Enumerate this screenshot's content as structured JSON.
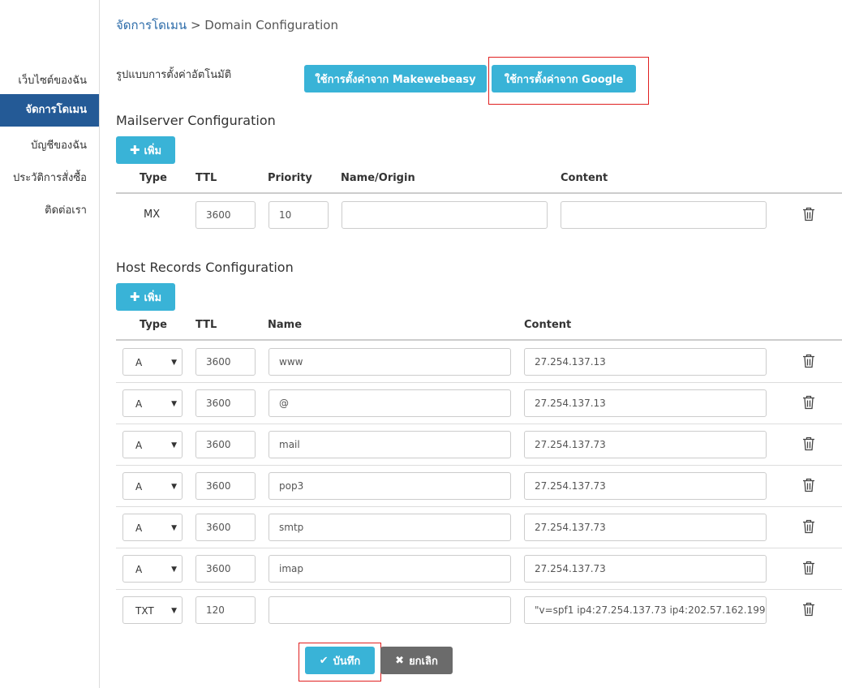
{
  "sidebar": {
    "items": [
      {
        "label": "เว็บไซต์ของฉัน",
        "active": false
      },
      {
        "label": "จัดการโดเมน",
        "active": true
      },
      {
        "label": "บัญชีของฉัน",
        "active": false
      },
      {
        "label": "ประวัติการสั่งซื้อ",
        "active": false
      },
      {
        "label": "ติดต่อเรา",
        "active": false
      }
    ]
  },
  "breadcrumb": {
    "parent": "จัดการโดเมน",
    "separator": " > ",
    "current": "Domain Configuration"
  },
  "preset": {
    "label": "รูปแบบการตั้งค่าอัตโนมัติ",
    "makewebeasy_button": "ใช้การตั้งค่าจาก Makewebeasy",
    "google_button": "ใช้การตั้งค่าจาก Google"
  },
  "mail": {
    "title": "Mailserver Configuration",
    "add_button": "เพิ่ม",
    "columns": {
      "type": "Type",
      "ttl": "TTL",
      "priority": "Priority",
      "name": "Name/Origin",
      "content": "Content"
    },
    "rows": [
      {
        "type": "MX",
        "ttl": "3600",
        "priority": "10",
        "name": "",
        "content": ""
      }
    ]
  },
  "host": {
    "title": "Host Records Configuration",
    "add_button": "เพิ่ม",
    "columns": {
      "type": "Type",
      "ttl": "TTL",
      "name": "Name",
      "content": "Content"
    },
    "rows": [
      {
        "type": "A",
        "ttl": "3600",
        "name": "www",
        "content": "27.254.137.13"
      },
      {
        "type": "A",
        "ttl": "3600",
        "name": "@",
        "content": "27.254.137.13"
      },
      {
        "type": "A",
        "ttl": "3600",
        "name": "mail",
        "content": "27.254.137.73"
      },
      {
        "type": "A",
        "ttl": "3600",
        "name": "pop3",
        "content": "27.254.137.73"
      },
      {
        "type": "A",
        "ttl": "3600",
        "name": "smtp",
        "content": "27.254.137.73"
      },
      {
        "type": "A",
        "ttl": "3600",
        "name": "imap",
        "content": "27.254.137.73"
      },
      {
        "type": "TXT",
        "ttl": "120",
        "name": "",
        "content": "\"v=spf1 ip4:27.254.137.73 ip4:202.57.162.199 ip"
      }
    ]
  },
  "actions": {
    "save_label": "บันทึก",
    "cancel_label": "ยกเลิก"
  },
  "colors": {
    "accent": "#39b3d7",
    "sidebar_active": "#245a96",
    "highlight": "#e02020",
    "cancel": "#6b6b6b"
  }
}
